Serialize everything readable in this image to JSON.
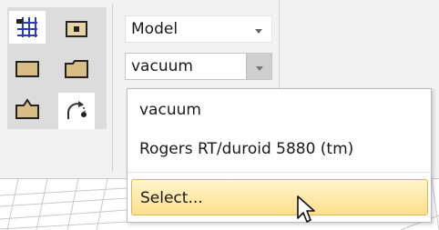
{
  "toolbar": {
    "tools": [
      {
        "icon": "grid-snap-icon",
        "active": true
      },
      {
        "icon": "solid-box-icon",
        "active": false
      },
      {
        "icon": "rectangle-icon",
        "active": false
      },
      {
        "icon": "folder-shape-icon",
        "active": false
      },
      {
        "icon": "extrude-shape-icon",
        "active": false
      },
      {
        "icon": "rotate-arc-icon",
        "active": true
      }
    ]
  },
  "model_combo": {
    "value": "Model"
  },
  "material_combo": {
    "value": "vacuum",
    "open": true
  },
  "material_dropdown": {
    "items": [
      "vacuum",
      "Rogers RT/duroid 5880 (tm)",
      "Select..."
    ],
    "highlighted": "Select..."
  },
  "colors": {
    "highlight_top": "#fff5cc",
    "highlight_bottom": "#fddf8c",
    "highlight_border": "#e0b84f",
    "icon_blue": "#2a3fb5",
    "icon_tan": "#d9bd85"
  }
}
